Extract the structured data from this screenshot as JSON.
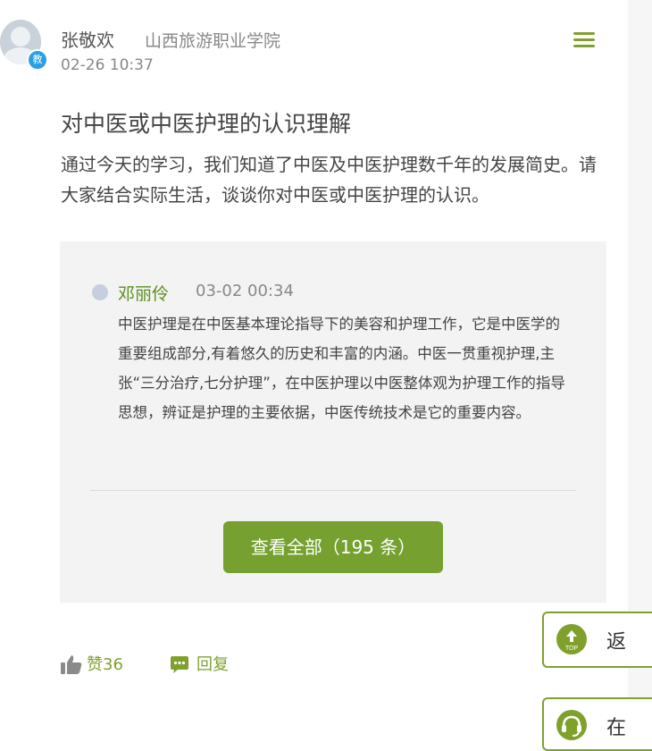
{
  "post": {
    "author": "张敬欢",
    "school": "山西旅游职业学院",
    "time": "02-26 10:37",
    "badge": "教",
    "title": "对中医或中医护理的认识理解",
    "body": "通过今天的学习，我们知道了中医及中医护理数千年的发展简史。请大家结合实际生活，谈谈你对中医或中医护理的认识。"
  },
  "reply": {
    "author": "邓丽伶",
    "time": "03-02 00:34",
    "body": "中医护理是在中医基本理论指导下的美容和护理工作，它是中医学的重要组成部分,有着悠久的历史和丰富的内涵。中医一贯重视护理,主张“三分治疗,七分护理”，在中医护理以中医整体观为护理工作的指导思想，辨证是护理的主要依据，中医传统技术是它的重要内容。"
  },
  "actions": {
    "view_all": "查看全部（195 条）",
    "like": "赞36",
    "reply": "回复"
  },
  "floating": {
    "top_label": "返",
    "top_icon_text": "TOP",
    "chat_label": "在"
  },
  "colors": {
    "accent": "#7fa12c",
    "button": "#76a030",
    "badge": "#2aa0e3",
    "reply_bg": "#f3f3f3"
  },
  "icons": [
    "menu-icon",
    "thumbs-up-icon",
    "comment-icon",
    "back-to-top-icon",
    "headset-icon",
    "avatar-icon"
  ]
}
